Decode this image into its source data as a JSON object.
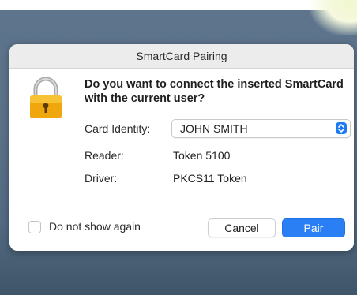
{
  "dialog": {
    "title": "SmartCard Pairing",
    "question": "Do you want to connect the inserted SmartCard with the current user?",
    "card_identity_label": "Card Identity:",
    "card_identity_value": "JOHN SMITH",
    "reader_label": "Reader:",
    "reader_value": "Token 5100",
    "driver_label": "Driver:",
    "driver_value": "PKCS11 Token",
    "checkbox_label": "Do not show again",
    "checkbox_checked": false,
    "cancel_label": "Cancel",
    "pair_label": "Pair"
  },
  "icons": {
    "lock": "lock-icon",
    "stepper": "chevron-updown-icon"
  },
  "colors": {
    "accent": "#2a7ff5",
    "lock_body": "#f2a90f",
    "desktop": "#5b7289"
  }
}
